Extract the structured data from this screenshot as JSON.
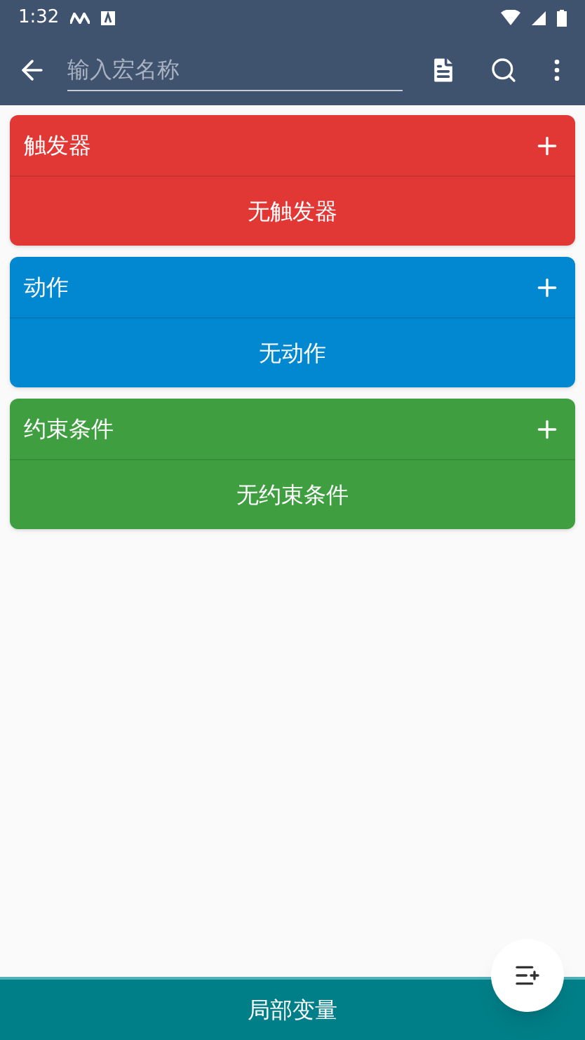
{
  "status_bar": {
    "time": "1:32"
  },
  "toolbar": {
    "placeholder": "输入宏名称"
  },
  "sections": [
    {
      "title": "触发器",
      "empty_text": "无触发器",
      "color": "#e23835"
    },
    {
      "title": "动作",
      "empty_text": "无动作",
      "color": "#0288d1"
    },
    {
      "title": "约束条件",
      "empty_text": "无约束条件",
      "color": "#3e9e40"
    }
  ],
  "bottom_bar": {
    "label": "局部变量"
  }
}
